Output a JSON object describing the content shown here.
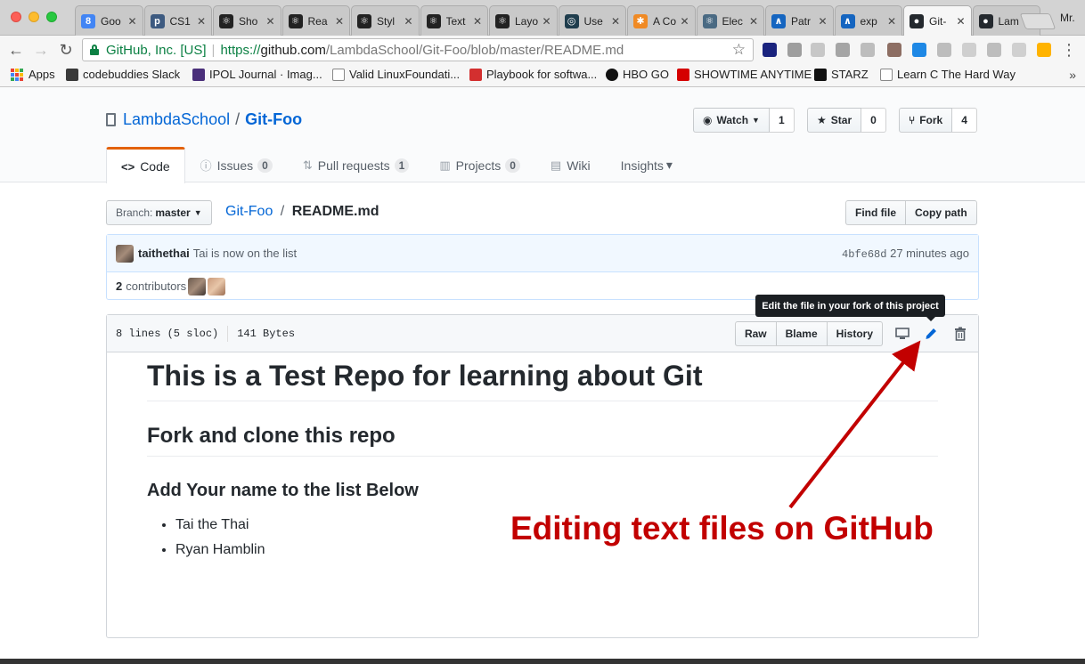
{
  "browser": {
    "tabs": [
      {
        "title": "Goo",
        "favicon_color": "#4285f4",
        "favicon_text": "8"
      },
      {
        "title": "CS1",
        "favicon_color": "#3d5a80",
        "favicon_text": "p"
      },
      {
        "title": "Sho",
        "favicon_color": "#222222",
        "favicon_text": "⚛"
      },
      {
        "title": "Rea",
        "favicon_color": "#222222",
        "favicon_text": "⚛"
      },
      {
        "title": "Styl",
        "favicon_color": "#222222",
        "favicon_text": "⚛"
      },
      {
        "title": "Text",
        "favicon_color": "#222222",
        "favicon_text": "⚛"
      },
      {
        "title": "Layo",
        "favicon_color": "#222222",
        "favicon_text": "⚛"
      },
      {
        "title": "Use",
        "favicon_color": "#1f3d4d",
        "favicon_text": "◎"
      },
      {
        "title": "A Co",
        "favicon_color": "#f08a24",
        "favicon_text": "✱"
      },
      {
        "title": "Elec",
        "favicon_color": "#4a6a83",
        "favicon_text": "⚛"
      },
      {
        "title": "Patr",
        "favicon_color": "#1565c0",
        "favicon_text": "∧"
      },
      {
        "title": "exp",
        "favicon_color": "#1565c0",
        "favicon_text": "∧"
      },
      {
        "title": "Git-",
        "favicon_color": "#24292e",
        "favicon_text": "●"
      },
      {
        "title": "Lam",
        "favicon_color": "#24292e",
        "favicon_text": "●"
      }
    ],
    "active_tab_index": 12,
    "profile_label": "Mr.",
    "address": {
      "ev_label": "GitHub, Inc. [US]",
      "scheme": "https://",
      "host": "github.com",
      "path": "/LambdaSchool/Git-Foo/blob/master/README.md"
    },
    "bookmarks": [
      {
        "label": "Apps",
        "icon": "apps-grid"
      },
      {
        "label": "codebuddies Slack",
        "icon": "hash-icon"
      },
      {
        "label": "IPOL Journal · Imag...",
        "icon": "ipol-icon"
      },
      {
        "label": "Valid LinuxFoundati...",
        "icon": "page-icon"
      },
      {
        "label": "Playbook for softwa...",
        "icon": "playbook-icon"
      },
      {
        "label": "HBO GO",
        "icon": "hbo-icon"
      },
      {
        "label": "SHOWTIME ANYTIME",
        "icon": "showtime-icon"
      },
      {
        "label": "STARZ",
        "icon": "starz-icon"
      },
      {
        "label": "Learn C The Hard Way",
        "icon": "page-icon"
      }
    ],
    "bookmarks_more": "»"
  },
  "repo": {
    "owner": "LambdaSchool",
    "slash": "/",
    "name": "Git-Foo",
    "watch_label": "Watch",
    "watch_count": "1",
    "star_label": "Star",
    "star_count": "0",
    "fork_label": "Fork",
    "fork_count": "4"
  },
  "nav": [
    {
      "label": "Code",
      "count": null,
      "icon": "code-icon",
      "selected": true
    },
    {
      "label": "Issues",
      "count": "0",
      "icon": "issue-icon",
      "selected": false
    },
    {
      "label": "Pull requests",
      "count": "1",
      "icon": "pr-icon",
      "selected": false
    },
    {
      "label": "Projects",
      "count": "0",
      "icon": "project-icon",
      "selected": false
    },
    {
      "label": "Wiki",
      "count": null,
      "icon": "wiki-icon",
      "selected": false
    },
    {
      "label": "Insights",
      "count": null,
      "icon": "dropdown-caret",
      "selected": false
    }
  ],
  "file": {
    "branch_prefix": "Branch:",
    "branch": "master",
    "breadcrumb_repo": "Git-Foo",
    "breadcrumb_sep": "/",
    "filename": "README.md",
    "find_file": "Find file",
    "copy_path": "Copy path",
    "lines_info": "8 lines (5 sloc)",
    "size_info": "141 Bytes",
    "raw": "Raw",
    "blame": "Blame",
    "history": "History"
  },
  "commit": {
    "author": "taithethai",
    "message": "Tai is now on the list",
    "sha": "4bfe68d",
    "time": "27 minutes ago",
    "contributors_count": "2",
    "contributors_label": "contributors"
  },
  "readme": {
    "h1": "This is a Test Repo for learning about Git",
    "h2": "Fork and clone this repo",
    "h3": "Add Your name to the list Below",
    "list": [
      "Tai the Thai",
      "Ryan Hamblin"
    ]
  },
  "tooltip": "Edit the file in your fork of this project",
  "annotation": {
    "text": "Editing text files on GitHub",
    "color": "#c20000"
  },
  "colors": {
    "link": "#0366d6",
    "nav_selected_accent": "#e36209"
  }
}
